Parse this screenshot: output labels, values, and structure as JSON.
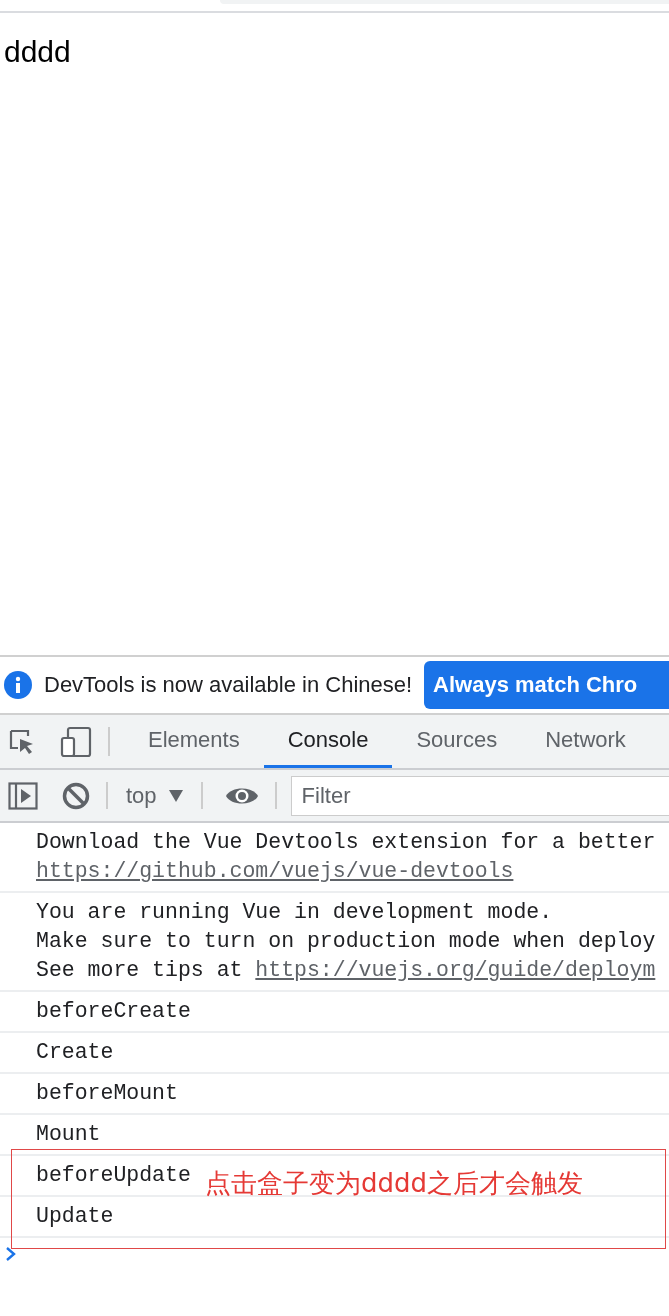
{
  "page": {
    "text": "dddd"
  },
  "infobar": {
    "message": "DevTools is now available in Chinese!",
    "button": "Always match Chro"
  },
  "devtools": {
    "tabs": [
      {
        "label": "Elements",
        "selected": false
      },
      {
        "label": "Console",
        "selected": true
      },
      {
        "label": "Sources",
        "selected": false
      },
      {
        "label": "Network",
        "selected": false
      }
    ],
    "toolbar": {
      "context": "top",
      "filter_placeholder": "Filter"
    },
    "messages": [
      {
        "lines": [
          {
            "text": "Download the Vue Devtools extension for a better"
          },
          {
            "link": "https://github.com/vuejs/vue-devtools"
          }
        ]
      },
      {
        "lines": [
          {
            "text": "You are running Vue in development mode."
          },
          {
            "text": "Make sure to turn on production mode when deploy"
          },
          {
            "text": "See more tips at ",
            "link": "https://vuejs.org/guide/deploym"
          }
        ]
      },
      {
        "lines": [
          {
            "text": "beforeCreate"
          }
        ]
      },
      {
        "lines": [
          {
            "text": "Create"
          }
        ]
      },
      {
        "lines": [
          {
            "text": "beforeMount"
          }
        ]
      },
      {
        "lines": [
          {
            "text": "Mount"
          }
        ]
      },
      {
        "lines": [
          {
            "text": "beforeUpdate"
          }
        ]
      },
      {
        "lines": [
          {
            "text": "Update"
          }
        ]
      }
    ]
  },
  "annotation": {
    "text": "点击盒子变为dddd之后才会触发"
  }
}
